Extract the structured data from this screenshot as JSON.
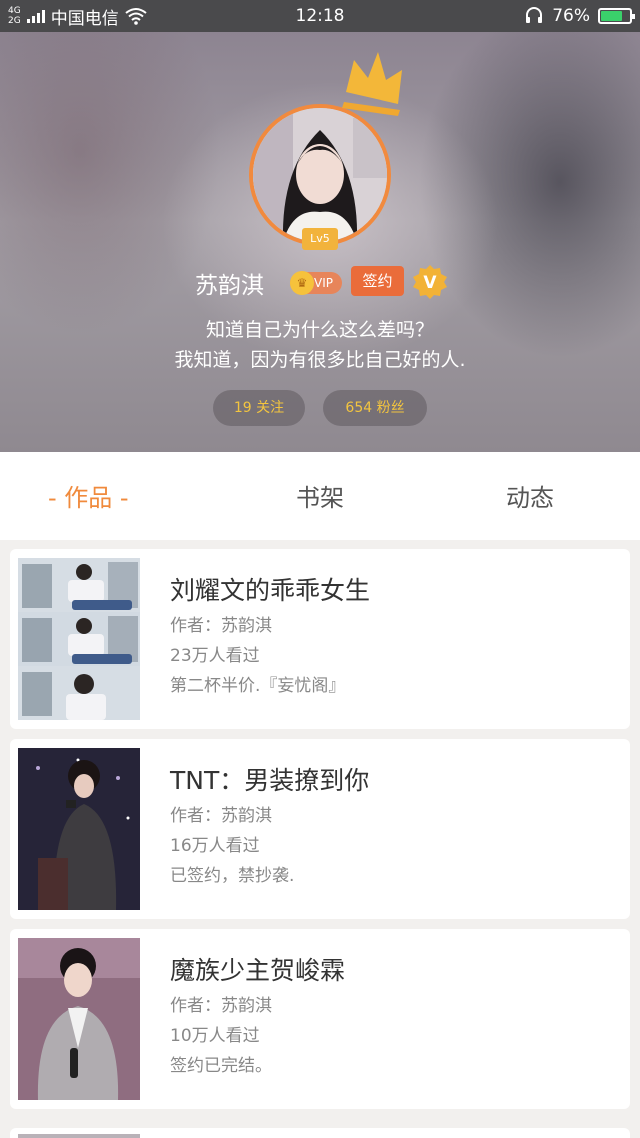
{
  "status_bar": {
    "network_top": "4G",
    "network_bottom": "2G",
    "carrier": "中国电信",
    "time": "12:18",
    "battery_percent": "76%",
    "battery_level": 0.76
  },
  "profile": {
    "level": "Lv5",
    "name": "苏韵淇",
    "vip_label": "VIP",
    "sign_label": "签约",
    "verified_letter": "V",
    "bio_line1": "知道自己为什么这么差吗？",
    "bio_line2": "我知道，因为有很多比自己好的人.",
    "follow_label": "19 关注",
    "fans_label": "654 粉丝"
  },
  "tabs": [
    {
      "label": "- 作品 -",
      "active": true
    },
    {
      "label": "书架",
      "active": false
    },
    {
      "label": "动态",
      "active": false
    }
  ],
  "works": [
    {
      "title": "刘耀文的乖乖女生",
      "author": "作者：苏韵淇",
      "views": "23万人看过",
      "note": "第二杯半价.『妄忧阁』"
    },
    {
      "title": "TNT：男装撩到你",
      "author": "作者：苏韵淇",
      "views": "16万人看过",
      "note": "已签约，禁抄袭."
    },
    {
      "title": "魔族少主贺峻霖",
      "author": "作者：苏韵淇",
      "views": "10万人看过",
      "note": "签约已完结。"
    }
  ],
  "colors": {
    "accent_orange": "#f08a3c",
    "gold": "#f3c53f",
    "sign_orange": "#ea6c3a"
  }
}
